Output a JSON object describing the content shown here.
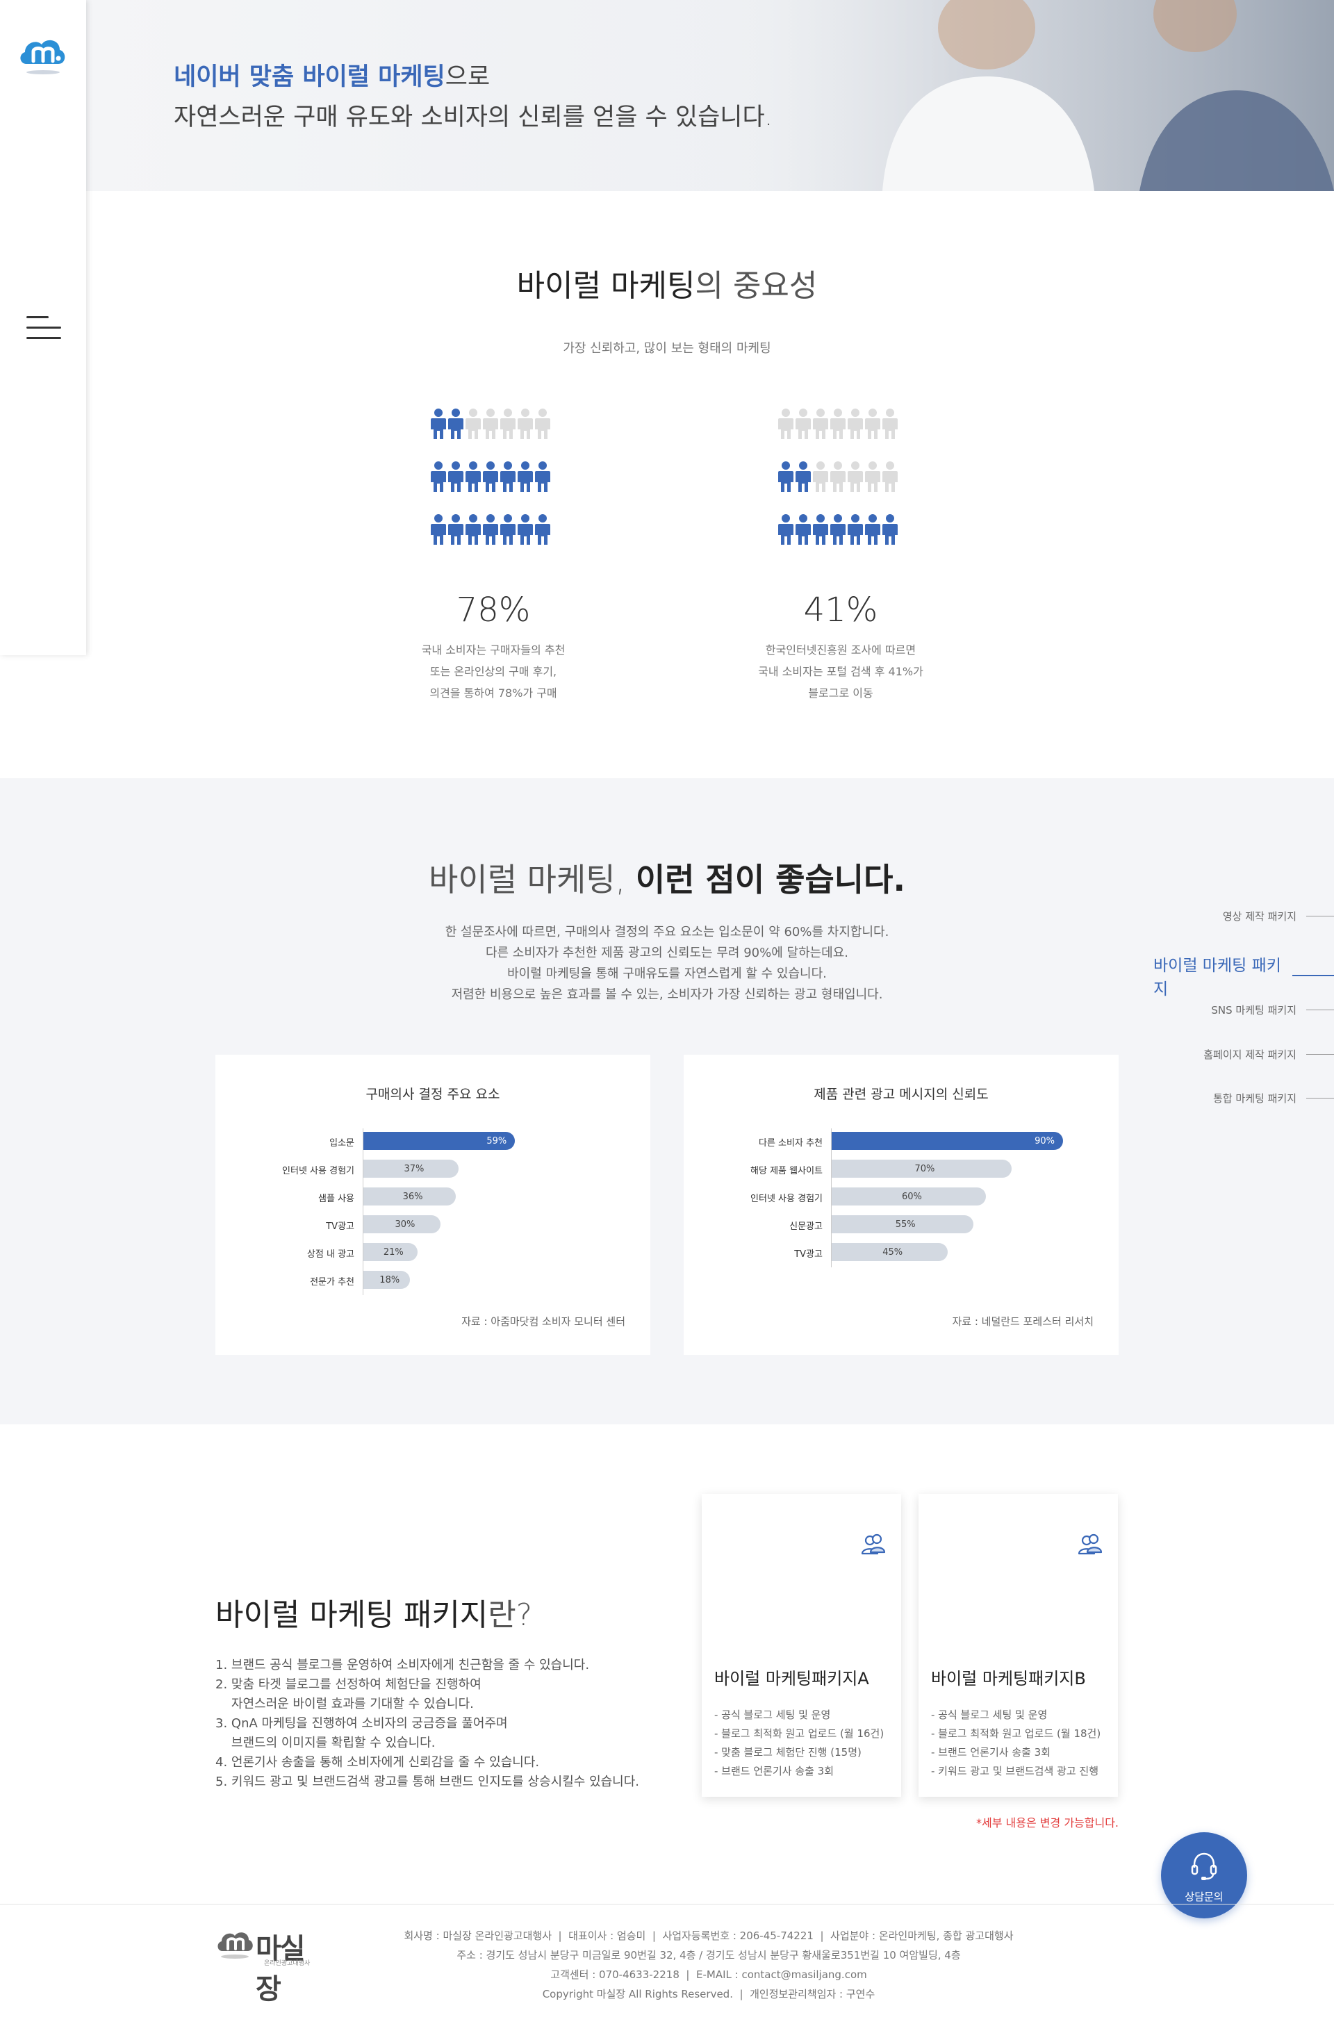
{
  "hero": {
    "line1_highlight": "네이버 맞춤 바이럴 마케팅",
    "line1_rest": "으로",
    "line2": "자연스러운 구매 유도와 소비자의 신뢰를 얻을 수 있습니다."
  },
  "importance": {
    "title_bold": "바이럴 마케팅",
    "title_light": "의 중요성",
    "subtitle": "가장 신뢰하고, 많이 보는 형태의 마케팅",
    "stats": [
      {
        "value": "78%",
        "fill_fraction": 0.78,
        "desc1": "국내 소비자는 구매자들의 추천",
        "desc2": "또는 온라인상의 구매 후기,",
        "desc3": "의견을 통하여 78%가 구매"
      },
      {
        "value": "41%",
        "fill_fraction": 0.41,
        "desc1": "한국인터넷진흥원 조사에 따르면",
        "desc2": "국내 소비자는 포털 검색 후 41%가",
        "desc3": "블로그로 이동"
      }
    ]
  },
  "benefits": {
    "title_light": "바이럴 마케팅,",
    "title_bold": "이런 점이 좋습니다.",
    "desc1": "한 설문조사에 따르면, 구매의사 결정의 주요 요소는 입소문이 약 60%를 차지합니다.",
    "desc2": "다른 소비자가 추천한 제품 광고의 신뢰도는 무려 90%에 달하는데요.",
    "desc3": "바이럴 마케팅을 통해 구매유도를 자연스럽게 할 수 있습니다.",
    "desc4": "저렴한 비용으로 높은 효과를 볼 수 있는, 소비자가 가장 신뢰하는 광고 형태입니다."
  },
  "chart_data": [
    {
      "type": "bar",
      "title": "구매의사 결정 주요 요소",
      "categories": [
        "입소문",
        "인터넷 사용 경험기",
        "샘플 사용",
        "TV광고",
        "상점 내 광고",
        "전문가 추천"
      ],
      "values": [
        59,
        37,
        36,
        30,
        21,
        18
      ],
      "labels": [
        "59%",
        "37%",
        "36%",
        "30%",
        "21%",
        "18%"
      ],
      "source": "자료 : 아줌마닷컴 소비자 모니터 센터",
      "xlim": [
        0,
        100
      ]
    },
    {
      "type": "bar",
      "title": "제품 관련 광고 메시지의 신뢰도",
      "categories": [
        "다른 소비자 추천",
        "해당 제품 웹사이트",
        "인터넷 사용 경험기",
        "신문광고",
        "TV광고"
      ],
      "values": [
        90,
        70,
        60,
        55,
        45
      ],
      "labels": [
        "90%",
        "70%",
        "60%",
        "55%",
        "45%"
      ],
      "source": "자료 : 네덜란드 포레스터 리서치",
      "xlim": [
        0,
        100
      ]
    }
  ],
  "rightnav": [
    {
      "label": "영상 제작 패키지",
      "active": false
    },
    {
      "label": "바이럴 마케팅 패키지",
      "active": true
    },
    {
      "label": "SNS 마케팅 패키지",
      "active": false
    },
    {
      "label": "홈페이지 제작 패키지",
      "active": false
    },
    {
      "label": "통합 마케팅 패키지",
      "active": false
    }
  ],
  "package": {
    "title_bold": "바이럴 마케팅 패키지",
    "title_light": "란?",
    "list": [
      "1. 브랜드 공식 블로그를 운영하여 소비자에게 친근함을 줄 수 있습니다.",
      "2. 맞춤 타겟 블로그를 선정하여 체험단을 진행하여",
      "    자연스러운 바이럴 효과를 기대할 수 있습니다.",
      "3. QnA 마케팅을 진행하여 소비자의 궁금증을 풀어주며",
      "    브랜드의 이미지를 확립할 수 있습니다.",
      "4. 언론기사 송출을 통해 소비자에게 신뢰감을 줄 수 있습니다.",
      "5. 키워드 광고 및 브랜드검색 광고를 통해 브랜드 인지도를 상승시킬수 있습니다."
    ],
    "cards": [
      {
        "name": "바이럴 마케팅패키지A",
        "items": [
          "- 공식 블로그 세팅 및 운영",
          "- 블로그 최적화 원고 업로드 (월 16건)",
          "- 맞춤 블로그 체험단 진행 (15명)",
          "- 브랜드 언론기사 송출 3회"
        ]
      },
      {
        "name": "바이럴 마케팅패키지B",
        "items": [
          "- 공식 블로그 세팅 및 운영",
          "- 블로그 최적화 원고 업로드 (월 18건)",
          "- 브랜드 언론기사 송출 3회",
          "- 키워드 광고 및 브랜드검색 광고 진행"
        ]
      }
    ],
    "note": "*세부 내용은 변경 가능합니다."
  },
  "fab": {
    "label": "상담문의"
  },
  "footer": {
    "logo_text": "마실장",
    "logo_sub": "온라인광고대행사",
    "line1": "회사명 : 마실장 온라인광고대행사  |  대표이사 : 엄승미  |  사업자등록번호 : 206-45-74221  |  사업분야 : 온라인마케팅, 종합 광고대행사",
    "line2": "주소 : 경기도 성남시 분당구 미금일로 90번길 32, 4층 / 경기도 성남시 분당구 황새울로351번길 10 여암빌딩, 4층",
    "line3": "고객센터 : 070-4633-2218  |  E-MAIL : contact@masiljang.com",
    "line4": "Copyright 마실장 All Rights Reserved.  |  개인정보관리책임자 : 구연수"
  },
  "colors": {
    "accent": "#3a68b8",
    "bar_gray": "#d3d9e1",
    "person_gray": "#dcdcdc",
    "note_red": "#e23a3a"
  }
}
